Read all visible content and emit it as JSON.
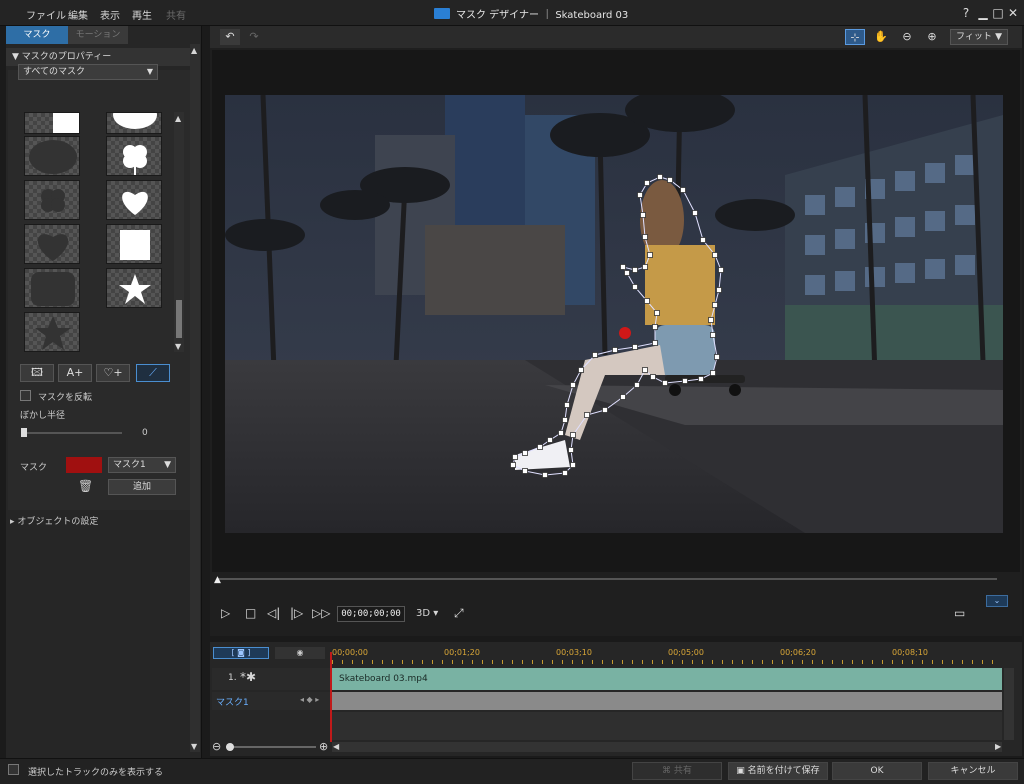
{
  "menu": {
    "file": "ファイル",
    "edit": "編集",
    "view": "表示",
    "play": "再生",
    "share": "共有"
  },
  "window": {
    "title": "マスク デザイナー ｜ Skateboard 03",
    "help": "?"
  },
  "tabs": {
    "mask": "マスク",
    "motion": "モーション"
  },
  "panel": {
    "properties_header": "マスクのプロパティー",
    "mask_filter": "すべてのマスク",
    "invert_label": "マスクを反転",
    "blur_label": "ぼかし半径",
    "blur_value": "0",
    "mask_label": "マスク",
    "mask_color": "#a01010",
    "mask_name": "マスク1",
    "add_button": "追加",
    "object_settings": "オブジェクトの設定"
  },
  "toolbar": {
    "zoom": "フィット"
  },
  "player": {
    "timecode": "00;00;00;00",
    "mode": "3D"
  },
  "timeline": {
    "ticks": [
      "00;00;00",
      "00;01;20",
      "00;03;10",
      "00;05;00",
      "00;06;20",
      "00;08;10"
    ],
    "track1_label": "1.",
    "clip_name": "Skateboard 03.mp4",
    "track2_label": "マスク1"
  },
  "footer": {
    "show_selected_only": "選択したトラックのみを表示する",
    "share": "共有",
    "save_as": "名前を付けて保存",
    "ok": "OK",
    "cancel": "キャンセル"
  },
  "icons": {
    "undo": "undo-icon",
    "redo": "redo-icon",
    "select": "select-move-icon",
    "hand": "hand-icon",
    "zoom_out": "zoom-out-icon",
    "zoom_in": "zoom-in-icon",
    "trash": "trash-icon",
    "fullscreen": "fullscreen-icon"
  }
}
